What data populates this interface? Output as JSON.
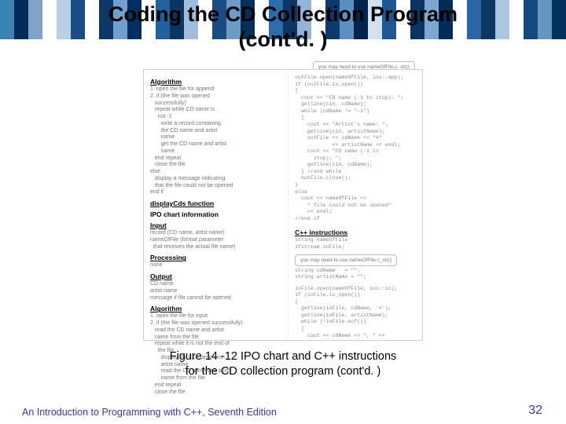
{
  "header": {
    "title_line1": "Coding the CD Collection Program",
    "title_line2": "(cont'd. )"
  },
  "banner_colors": [
    "#3a82b5",
    "#012b59",
    "#7ea3c7",
    "#ffffff",
    "#b7d0e6",
    "#1a4d86",
    "#ffffff",
    "#0e3766",
    "#6fa0cf",
    "#043061",
    "#ffffff",
    "#2161a2",
    "#0b3563",
    "#a0bddc",
    "#ffffff",
    "#1a4b82",
    "#6e9ac6",
    "#05305e",
    "#ffffff",
    "#2d6cac",
    "#0c3764",
    "#93b4d7",
    "#ffffff",
    "#0e3a6a",
    "#5c8fc1",
    "#02254d",
    "#d2e1ef",
    "#1f5694",
    "#ffffff",
    "#0a3461",
    "#7fa6cf",
    "#012b59",
    "#ffffff",
    "#2a66a7",
    "#0c3764",
    "#a9c5e1",
    "#ffffff",
    "#154780",
    "#6694c3",
    "#04305e"
  ],
  "callout": "you may need to use\nnameOfFile.c_str()",
  "figure": {
    "left": {
      "algo_head": "Algorithm",
      "algo1": "1. open the file for append\n2. if (the file was opened\n   successfully)",
      "algo2": "   repeat while CD name is\n     not -1\n       write a record containing\n       the CD name and artist\n       name\n       get the CD name and artist\n       name\n   end repeat\n   close the file",
      "algo3": "else\n   display a message indicating\n   that the file could not be opened\nend if",
      "disp_head": "displayCds function",
      "ipo_head": "IPO chart information",
      "input_head": "Input",
      "input_txt": "record (CD name, artist name)\nnameOfFile (formal parameter\n  that receives the actual file name)",
      "proc_head": "Processing",
      "proc_txt": "none",
      "output_head": "Output",
      "output_txt": "CD name\nartist name\nmessage if file cannot be opened",
      "algo2_head": "Algorithm",
      "algo2_txt": "1. open the file for input\n2. if (the file was opened successfully)\n   read the CD name and artist\n   name from the file\n   repeat while it is not the end of\n     the file\n       display the CD name and\n       artist name\n       read the CD name and artist\n       name from the file\n   end repeat\n   close the file"
    },
    "right": {
      "code1": "outFile.open(nameOfFile, ios::app);\nif (outFile.is_open())\n{\n  cout << \"CD name (-1 to stop): \";\n  getline(cin, cdName);\n  while (cdName != \"-1\")\n  {\n    cout << \"Artist's name: \";\n    getline(cin, artistName);\n    outFile << cdName << \"#\"\n            << artistName << endl;\n    cout << \"CD name (-1 to\n      stop): \";\n    getline(cin, cdName);\n  } //end while\n  outFile.close();\n}\nelse\n  cout << nameOfFile <<\n    \" file could not be opened\"\n    << endl;\n//end if",
      "cpp_head": "C++ instructions",
      "code2": "string nameOfFile\nifstream inFile;",
      "code3": "string cdName   = \"\";\nstring artistName = \"\";",
      "code4": "inFile.open(nameOfFile, ios::in);\nif (inFile.is_open())\n{\n  getline(inFile, cdName, '#');\n  getline(inFile, artistName);\n  while (!inFile.eof())\n  {\n    cout << cdName << \", \" <<"
    }
  },
  "caption": {
    "line1": "Figure 14 -12 IPO chart and C++ instructions",
    "line2": "for the CD collection program (cont'd. )"
  },
  "footer": {
    "left": "An Introduction to Programming with C++, Seventh Edition",
    "page": "32"
  }
}
